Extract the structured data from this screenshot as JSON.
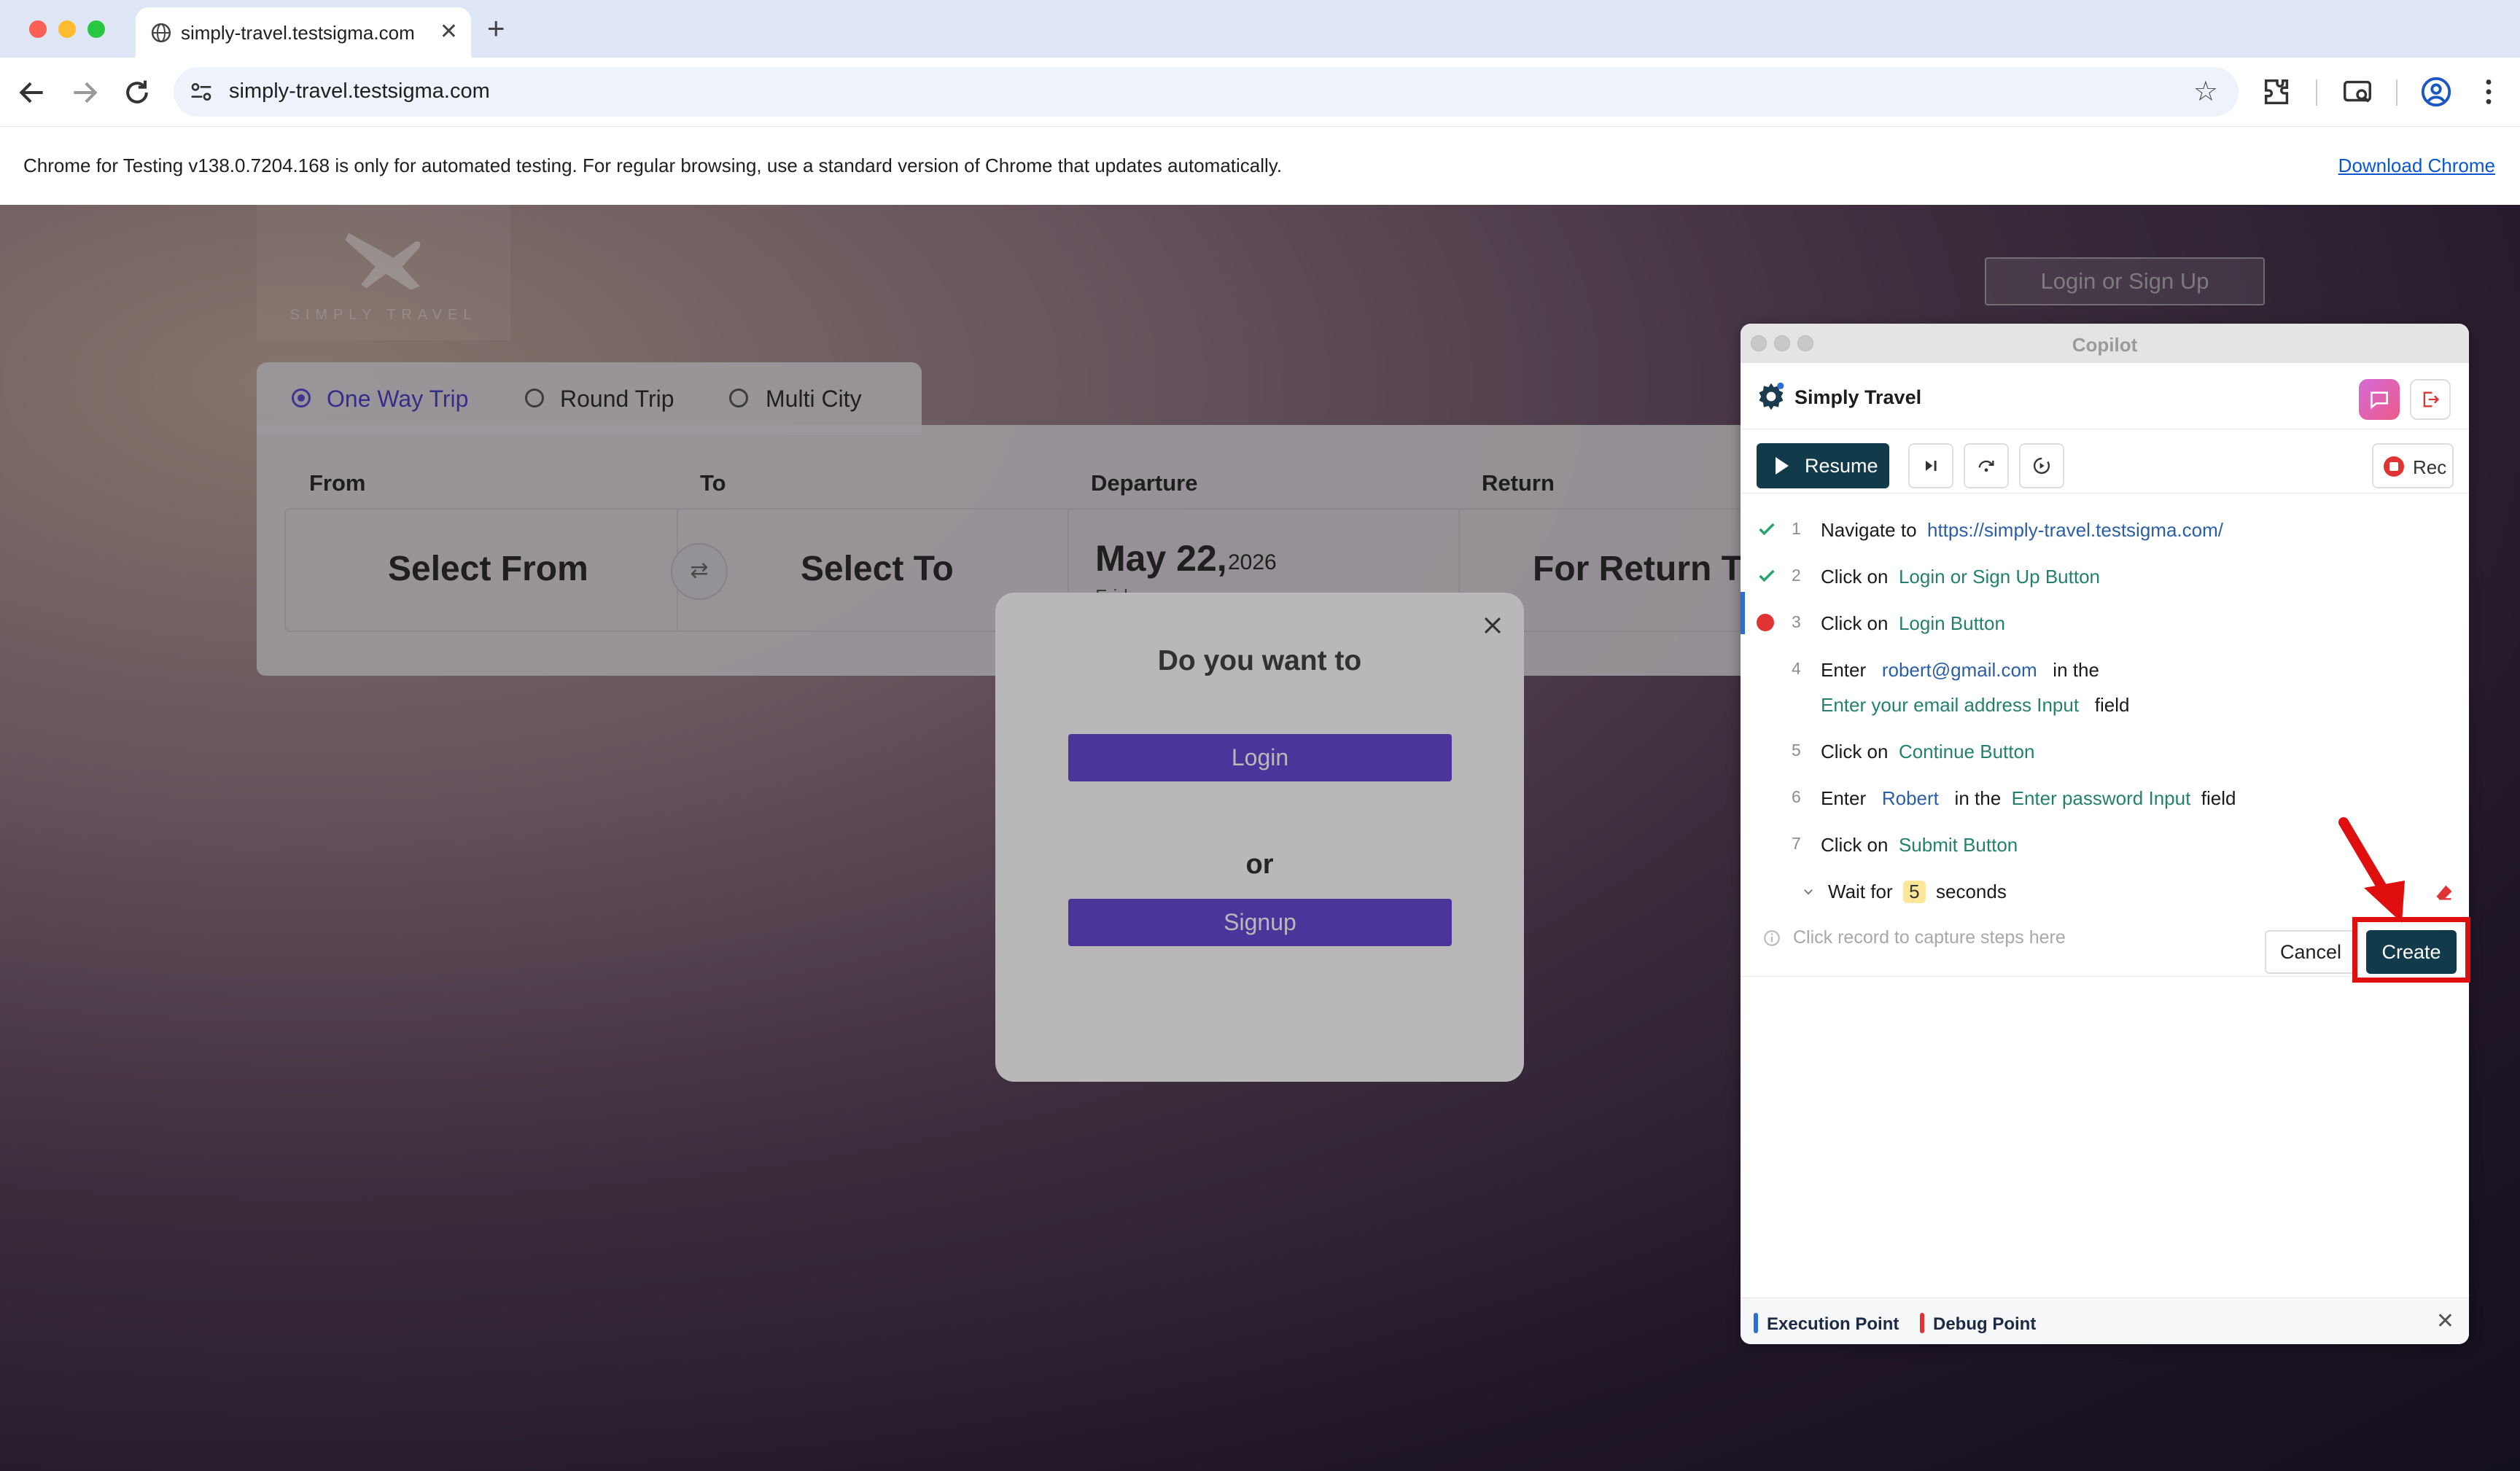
{
  "browser": {
    "tab_title": "simply-travel.testsigma.com",
    "url": "simply-travel.testsigma.com",
    "info_text": "Chrome for Testing v138.0.7204.168 is only for automated testing. For regular browsing, use a standard version of Chrome that updates automatically.",
    "info_link": "Download Chrome",
    "icons": [
      "back-icon",
      "forward-icon",
      "reload-icon",
      "site-info-icon",
      "bookmark-star-icon",
      "extensions-icon",
      "cast-search-icon",
      "profile-icon",
      "menu-kebab-icon"
    ]
  },
  "page": {
    "logo_text": "SIMPLY TRAVEL",
    "login_signup": "Login or Sign Up",
    "trip_types": [
      {
        "label": "One Way Trip",
        "selected": true
      },
      {
        "label": "Round Trip",
        "selected": false
      },
      {
        "label": "Multi City",
        "selected": false
      }
    ],
    "columns": {
      "from": "From",
      "to": "To",
      "departure": "Departure",
      "return": "Return"
    },
    "fields": {
      "from": "Select From",
      "to": "Select To",
      "departure_date": "May 22,",
      "departure_year": "2026",
      "departure_day": "Friday",
      "return": "For Return Trip"
    }
  },
  "modal": {
    "title": "Do you want to",
    "login": "Login",
    "or": "or",
    "signup": "Signup"
  },
  "copilot": {
    "window_title": "Copilot",
    "app_name": "Simply Travel",
    "resume": "Resume",
    "rec": "Rec",
    "steps": [
      {
        "n": "1",
        "status": "done",
        "kw1": "Navigate to",
        "value": "https://simply-travel.testsigma.com/"
      },
      {
        "n": "2",
        "status": "done",
        "kw1": "Click on",
        "element": "Login or Sign Up Button"
      },
      {
        "n": "3",
        "status": "breakpoint",
        "kw1": "Click on",
        "element": "Login Button"
      },
      {
        "n": "4",
        "status": "pending",
        "kw1": "Enter",
        "value": "robert@gmail.com",
        "kw2": "in the",
        "element": "Enter your email address Input",
        "kw3": "field"
      },
      {
        "n": "5",
        "status": "pending",
        "kw1": "Click on",
        "element": "Continue Button"
      },
      {
        "n": "6",
        "status": "pending",
        "kw1": "Enter",
        "value": "Robert",
        "kw2": "in the",
        "element": "Enter password Input",
        "kw3": "field"
      },
      {
        "n": "7",
        "status": "pending",
        "kw1": "Click on",
        "element": "Submit Button"
      }
    ],
    "wait": {
      "pre": "Wait for",
      "value": "5",
      "post": "seconds"
    },
    "hint": "Click record to capture steps here",
    "cancel": "Cancel",
    "create": "Create",
    "legend_exec": "Execution Point",
    "legend_debug": "Debug Point",
    "colors": {
      "primary": "#113a4a",
      "element": "#24806e",
      "value": "#2a5ea8",
      "execution": "#2b6fd6",
      "debug": "#e03434",
      "modal_button": "#6848d6",
      "annotation": "#e00f0f"
    }
  }
}
